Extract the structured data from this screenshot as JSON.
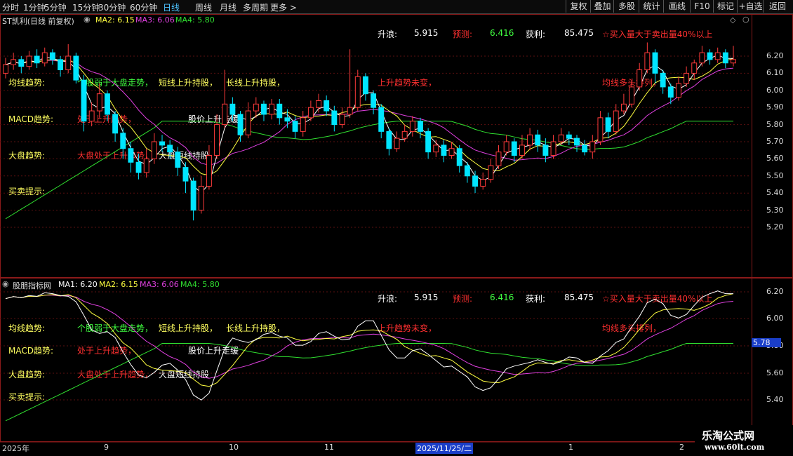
{
  "toolbar": {
    "periods": [
      "分时",
      "1分钟",
      "5分钟",
      "15分钟",
      "30分钟",
      "60分钟",
      "日线",
      "周线",
      "月线",
      "多周期",
      "更多 >"
    ],
    "active_period": "日线",
    "buttons": [
      "复权",
      "叠加",
      "多股",
      "统计",
      "画线",
      "F10",
      "标记",
      "+自选",
      "返回"
    ]
  },
  "main_panel": {
    "title": "ST凯利(日线 前复权)",
    "ma2": "MA2: 6.15",
    "ma3": "MA3: 6.06",
    "ma4": "MA4: 5.80",
    "stats": {
      "rise_label": "升浪:",
      "rise_value": "5.915",
      "predict_label": "预测:",
      "predict_value": "6.416",
      "profit_label": "获利:",
      "profit_value": "85.475",
      "signal": "☆买入量大于卖出量40%以上"
    },
    "row_labels": [
      "均线趋势:",
      "MACD趋势:",
      "大盘趋势:",
      "买卖提示:"
    ],
    "trend_texts": {
      "t1": "个股弱于大盘走势，",
      "t2": "短线上升持股，",
      "t3": "长线上升持股，",
      "t4": "上升趋势未变，",
      "t5": "均线多头排列，",
      "macd1": "处于上升趋势，",
      "macd2": "股价上升走缓",
      "mkt1": "大盘处于上升趋势，",
      "mkt2": "大盘短线持股"
    },
    "y_ticks": [
      "6.20",
      "6.10",
      "6.00",
      "5.90",
      "5.80",
      "5.70",
      "5.60",
      "5.50",
      "5.40",
      "5.30",
      "5.20"
    ]
  },
  "sub_panel": {
    "title": "股朋指标网",
    "ma1": "MA1: 6.20",
    "ma2": "MA2: 6.15",
    "ma3": "MA3: 6.06",
    "ma4": "MA4: 5.80",
    "stats": {
      "rise_label": "升浪:",
      "rise_value": "5.915",
      "predict_label": "预测:",
      "predict_value": "6.416",
      "profit_label": "获利:",
      "profit_value": "85.475",
      "signal": "☆买入量大于卖出量40%以上"
    },
    "row_labels": [
      "均线趋势:",
      "MACD趋势:",
      "大盘趋势:",
      "买卖提示:"
    ],
    "trend_texts": {
      "t1": "个股弱于大盘走势，",
      "t2": "短线上升持股，",
      "t3": "长线上升持股，",
      "t4": "上升趋势未变，",
      "t5": "均线多头排列，",
      "macd1": "处于上升趋势，",
      "macd2": "股价上升走缓",
      "mkt1": "大盘处于上升趋势，",
      "mkt2": "大盘短线持股"
    },
    "y_ticks": [
      "6.20",
      "6.00",
      "5.80",
      "5.60",
      "5.40"
    ],
    "cursor_value": "5.78"
  },
  "x_axis": {
    "labels": [
      "2025年",
      "9",
      "10",
      "11",
      "2025/11/25/二",
      "1",
      "2"
    ]
  },
  "watermark": {
    "title": "乐淘公式网",
    "url": "www.60lt.com"
  },
  "colors": {
    "up": "#ff3b3b",
    "down": "#00e5ff",
    "ma_white": "#ffffff",
    "ma_yellow": "#ffff40",
    "ma_magenta": "#e040e0",
    "ma_green": "#30e030",
    "text_yellow": "#ffff60",
    "text_red": "#ff3030",
    "text_green": "#40ff40",
    "text_magenta": "#ff40ff"
  },
  "chart_data": {
    "type": "candlestick",
    "title": "ST凯利(日线 前复权)",
    "ylim": [
      5.15,
      6.3
    ],
    "y_ticks": [
      5.2,
      5.3,
      5.4,
      5.5,
      5.6,
      5.7,
      5.8,
      5.9,
      6.0,
      6.1,
      6.2
    ],
    "candles": [
      [
        6.1,
        6.15,
        6.19,
        6.07
      ],
      [
        6.15,
        6.18,
        6.22,
        6.12
      ],
      [
        6.18,
        6.14,
        6.2,
        6.1
      ],
      [
        6.14,
        6.2,
        6.23,
        6.12
      ],
      [
        6.2,
        6.16,
        6.24,
        6.13
      ],
      [
        6.16,
        6.22,
        6.25,
        6.14
      ],
      [
        6.22,
        6.18,
        6.24,
        6.15
      ],
      [
        6.18,
        6.12,
        6.2,
        6.08
      ],
      [
        6.12,
        6.2,
        6.27,
        6.1
      ],
      [
        6.2,
        6.06,
        6.22,
        6.04
      ],
      [
        6.06,
        5.82,
        6.09,
        5.76
      ],
      [
        5.82,
        5.88,
        5.93,
        5.79
      ],
      [
        5.88,
        5.98,
        6.04,
        5.84
      ],
      [
        5.98,
        5.86,
        6.0,
        5.82
      ],
      [
        5.86,
        5.75,
        5.88,
        5.7
      ],
      [
        5.75,
        5.66,
        5.78,
        5.6
      ],
      [
        5.66,
        5.58,
        5.7,
        5.52
      ],
      [
        5.58,
        5.52,
        5.63,
        5.48
      ],
      [
        5.52,
        5.6,
        5.66,
        5.49
      ],
      [
        5.6,
        5.7,
        5.75,
        5.57
      ],
      [
        5.7,
        5.68,
        5.74,
        5.64
      ],
      [
        5.68,
        5.64,
        5.71,
        5.6
      ],
      [
        5.64,
        5.55,
        5.67,
        5.5
      ],
      [
        5.55,
        5.47,
        5.58,
        5.4
      ],
      [
        5.47,
        5.3,
        5.49,
        5.24
      ],
      [
        5.3,
        5.44,
        5.5,
        5.28
      ],
      [
        5.44,
        5.62,
        5.68,
        5.42
      ],
      [
        5.62,
        5.8,
        5.86,
        5.6
      ],
      [
        5.8,
        5.92,
        6.12,
        5.78
      ],
      [
        5.92,
        5.86,
        5.96,
        5.82
      ],
      [
        5.86,
        5.74,
        5.88,
        5.7
      ],
      [
        5.74,
        5.88,
        5.93,
        5.72
      ],
      [
        5.88,
        5.92,
        5.96,
        5.84
      ],
      [
        5.92,
        5.86,
        5.94,
        5.82
      ],
      [
        5.86,
        5.92,
        5.95,
        5.83
      ],
      [
        5.92,
        5.84,
        5.95,
        5.8
      ],
      [
        5.84,
        5.82,
        5.89,
        5.78
      ],
      [
        5.82,
        5.76,
        5.85,
        5.72
      ],
      [
        5.76,
        5.84,
        5.88,
        5.73
      ],
      [
        5.84,
        5.9,
        5.94,
        5.82
      ],
      [
        5.9,
        5.94,
        5.98,
        5.87
      ],
      [
        5.94,
        5.88,
        5.97,
        5.85
      ],
      [
        5.88,
        5.8,
        5.91,
        5.76
      ],
      [
        5.8,
        5.86,
        5.9,
        5.78
      ],
      [
        5.86,
        5.9,
        6.24,
        5.84
      ],
      [
        5.9,
        6.08,
        6.12,
        5.88
      ],
      [
        6.08,
        5.98,
        6.1,
        5.94
      ],
      [
        5.98,
        5.9,
        6.0,
        5.86
      ],
      [
        5.9,
        5.76,
        5.92,
        5.72
      ],
      [
        5.76,
        5.66,
        5.78,
        5.62
      ],
      [
        5.66,
        5.72,
        5.76,
        5.64
      ],
      [
        5.72,
        5.76,
        5.8,
        5.7
      ],
      [
        5.76,
        5.82,
        5.85,
        5.73
      ],
      [
        5.82,
        5.76,
        5.84,
        5.72
      ],
      [
        5.76,
        5.64,
        5.78,
        5.6
      ],
      [
        5.64,
        5.68,
        5.71,
        5.61
      ],
      [
        5.68,
        5.62,
        5.71,
        5.58
      ],
      [
        5.62,
        5.66,
        5.7,
        5.6
      ],
      [
        5.66,
        5.56,
        5.68,
        5.52
      ],
      [
        5.56,
        5.5,
        5.58,
        5.46
      ],
      [
        5.5,
        5.44,
        5.53,
        5.4
      ],
      [
        5.44,
        5.48,
        5.52,
        5.42
      ],
      [
        5.48,
        5.56,
        5.6,
        5.46
      ],
      [
        5.56,
        5.64,
        5.68,
        5.54
      ],
      [
        5.64,
        5.7,
        5.74,
        5.62
      ],
      [
        5.7,
        5.62,
        5.72,
        5.58
      ],
      [
        5.62,
        5.68,
        5.74,
        5.6
      ],
      [
        5.68,
        5.74,
        5.78,
        5.65
      ],
      [
        5.74,
        5.68,
        5.77,
        5.64
      ],
      [
        5.68,
        5.62,
        5.72,
        5.58
      ],
      [
        5.62,
        5.7,
        5.74,
        5.6
      ],
      [
        5.7,
        5.74,
        5.78,
        5.68
      ],
      [
        5.74,
        5.72,
        5.76,
        5.68
      ],
      [
        5.72,
        5.68,
        5.74,
        5.64
      ],
      [
        5.68,
        5.64,
        5.71,
        5.62
      ],
      [
        5.64,
        5.7,
        5.74,
        5.6
      ],
      [
        5.7,
        5.84,
        5.88,
        5.68
      ],
      [
        5.84,
        5.76,
        5.87,
        5.72
      ],
      [
        5.76,
        5.88,
        5.92,
        5.74
      ],
      [
        5.88,
        5.92,
        5.98,
        5.86
      ],
      [
        5.92,
        6.02,
        6.06,
        5.9
      ],
      [
        6.02,
        6.12,
        6.16,
        6.0
      ],
      [
        6.12,
        6.22,
        6.28,
        6.1
      ],
      [
        6.22,
        6.1,
        6.24,
        6.04
      ],
      [
        6.1,
        6.02,
        6.12,
        5.98
      ],
      [
        6.02,
        5.96,
        6.04,
        5.92
      ],
      [
        5.96,
        6.04,
        6.08,
        5.94
      ],
      [
        6.04,
        6.1,
        6.14,
        6.02
      ],
      [
        6.1,
        6.16,
        6.18,
        6.06
      ],
      [
        6.16,
        6.22,
        6.26,
        6.14
      ],
      [
        6.22,
        6.18,
        6.24,
        6.15
      ],
      [
        6.18,
        6.22,
        6.25,
        6.16
      ],
      [
        6.22,
        6.16,
        6.24,
        6.13
      ],
      [
        6.16,
        6.18,
        6.26,
        6.14
      ]
    ]
  }
}
